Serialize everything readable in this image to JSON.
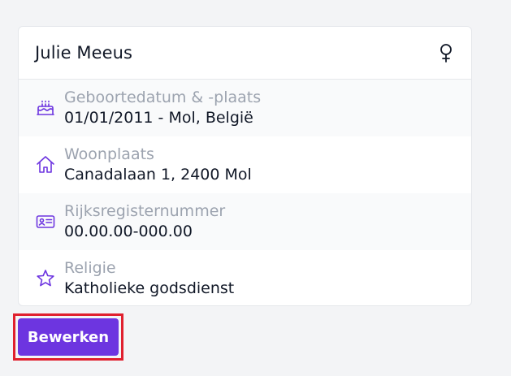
{
  "person": {
    "name": "Julie Meeus",
    "gender_icon": "female-icon"
  },
  "fields": [
    {
      "icon": "cake-icon",
      "label": "Geboortedatum & -plaats",
      "value": "01/01/2011 - Mol, België"
    },
    {
      "icon": "home-icon",
      "label": "Woonplaats",
      "value": "Canadalaan 1, 2400 Mol"
    },
    {
      "icon": "id-card-icon",
      "label": "Rijksregisternummer",
      "value": "00.00.00-000.00"
    },
    {
      "icon": "star-icon",
      "label": "Religie",
      "value": "Katholieke godsdienst"
    }
  ],
  "actions": {
    "edit_label": "Bewerken"
  },
  "colors": {
    "accent": "#6d35e0",
    "highlight": "#e0202e",
    "label": "#9ca3af",
    "icon": "#6d35e0"
  }
}
